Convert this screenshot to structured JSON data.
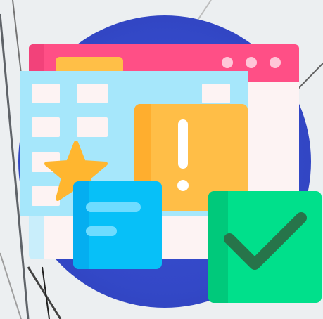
{
  "illustration": {
    "subject": "browser-window-with-alert-note-star-and-checkmark",
    "icons": [
      "browser-window",
      "exclamation",
      "note",
      "star",
      "checkmark"
    ],
    "colors": {
      "background": "#eceff1",
      "circle": "#3348c7",
      "titlebar": "#ff4f86",
      "tab": "#ffbf47",
      "window": "#fdf3f3",
      "grid": "#a6e7fb",
      "alert": "#ffbe47",
      "note": "#07c0f8",
      "star": "#ffb62f",
      "check_card": "#00e08b",
      "check_mark": "#27744a"
    }
  }
}
